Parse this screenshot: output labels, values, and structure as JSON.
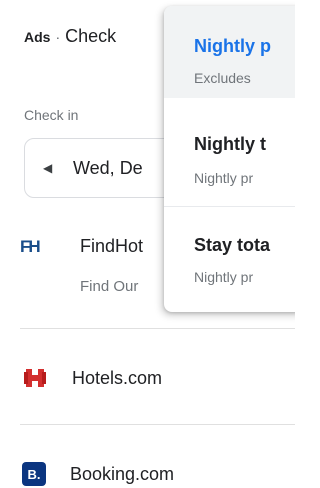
{
  "header": {
    "ads_label": "Ads",
    "separator": "·",
    "title": "Check"
  },
  "checkin": {
    "label": "Check in",
    "prev_icon": "◀",
    "date": "Wed, De"
  },
  "providers": [
    {
      "logo_text": "FH",
      "name": "FindHot",
      "subtitle": "Find Our",
      "logo_icon": "findhotel-logo-icon"
    },
    {
      "name": "Hotels.com",
      "logo_icon": "hotels-com-logo-icon",
      "logo_color": "#d32f2f"
    },
    {
      "logo_text": "B.",
      "name": "Booking.com",
      "logo_icon": "booking-com-logo-icon",
      "logo_color": "#0b3580"
    }
  ],
  "price_menu": {
    "items": [
      {
        "title": "Nightly p",
        "subtitle": "Excludes",
        "selected": true
      },
      {
        "title": "Nightly t",
        "subtitle": "Nightly pr",
        "selected": false
      },
      {
        "title": "Stay tota",
        "subtitle": "Nightly pr",
        "selected": false
      }
    ]
  },
  "colors": {
    "accent_blue": "#1a73e8",
    "text_primary": "#202124",
    "text_secondary": "#70757a"
  }
}
